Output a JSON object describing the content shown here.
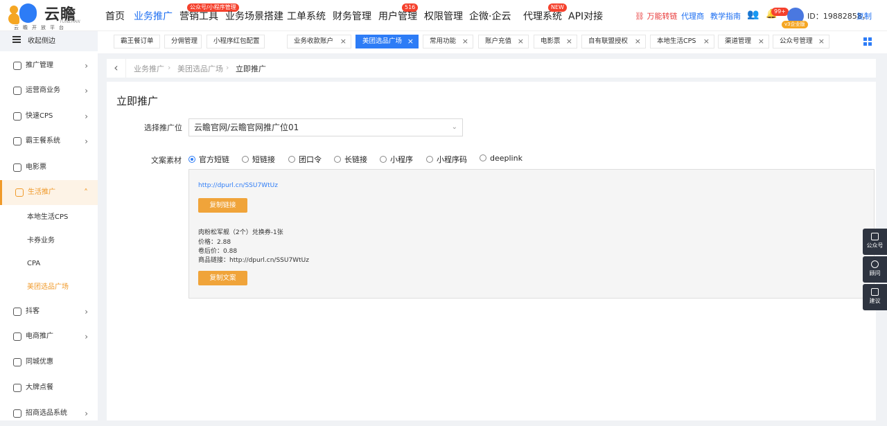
{
  "brand": {
    "name": "云瞻",
    "sub": "云瞻开放平台",
    "en": "YUNZHAN"
  },
  "nav": [
    {
      "label": "首页"
    },
    {
      "label": "业务推广",
      "active": true
    },
    {
      "label": "营销工具",
      "badge": "公众号/小程序管理"
    },
    {
      "label": "业务场景搭建"
    },
    {
      "label": "工单系统"
    },
    {
      "label": "财务管理"
    },
    {
      "label": "用户管理",
      "badge": "516"
    },
    {
      "label": "权限管理"
    },
    {
      "label": "企微·企云"
    },
    {
      "label": "代理系统",
      "badge": "NEW"
    },
    {
      "label": "API对接"
    }
  ],
  "header_right": {
    "convert": "万能转链",
    "agent": "代理商",
    "guide": "教学指南",
    "notify_badge": "99+",
    "vip": "v3企业版",
    "user_id": "ID：19882858，",
    "copy": "复制"
  },
  "sidebar": {
    "collapse": "收起侧边",
    "items": [
      {
        "label": "推广管理",
        "icon": "promo-icon"
      },
      {
        "label": "运营商业务",
        "icon": "operator-icon"
      },
      {
        "label": "快速CPS",
        "icon": "truck-icon"
      },
      {
        "label": "霸王餐系统",
        "icon": "meal-icon"
      },
      {
        "label": "电影票",
        "icon": "film-icon"
      },
      {
        "label": "生活推广",
        "icon": "life-icon",
        "open": true
      },
      {
        "label": "抖客",
        "icon": "douyin-icon"
      },
      {
        "label": "电商推广",
        "icon": "shop-icon"
      },
      {
        "label": "同城优惠",
        "icon": "location-icon"
      },
      {
        "label": "大牌点餐",
        "icon": "food-icon"
      },
      {
        "label": "招商选品系统",
        "icon": "select-icon"
      }
    ],
    "sub_items": [
      "本地生活CPS",
      "卡券业务",
      "CPA",
      "美团选品广场"
    ]
  },
  "tabs": [
    {
      "label": "霸王餐订单"
    },
    {
      "label": "分佣管理"
    },
    {
      "label": "小程序红包配置"
    },
    {
      "label": "业务收款账户"
    },
    {
      "label": "美团选品广场",
      "active": true
    },
    {
      "label": "常用功能"
    },
    {
      "label": "账户充值"
    },
    {
      "label": "电影票"
    },
    {
      "label": "自有联盟授权"
    },
    {
      "label": "本地生活CPS"
    },
    {
      "label": "渠道管理"
    },
    {
      "label": "公众号管理"
    }
  ],
  "breadcrumb": [
    "业务推广",
    "美团选品广场",
    "立即推广"
  ],
  "page": {
    "title": "立即推广",
    "select_label": "选择推广位",
    "select_value": "云瞻官网/云瞻官网推广位01",
    "material_label": "文案素材",
    "radios": [
      "官方短链",
      "短链接",
      "团口令",
      "长链接",
      "小程序",
      "小程序码",
      "deeplink"
    ],
    "selected_radio": "官方短链",
    "link": "http://dpurl.cn/SSU7WtUz",
    "copy_link": "复制链接",
    "product": "肉粉松军舰（2个）兑换券-1张",
    "price": "价格：2.88",
    "coupon_price": "卷后价：0.88",
    "product_link": "商品链接：http://dpurl.cn/SSU7WtUz",
    "copy_text": "复制文案"
  },
  "float": [
    "公众号",
    "顾问",
    "建议"
  ]
}
